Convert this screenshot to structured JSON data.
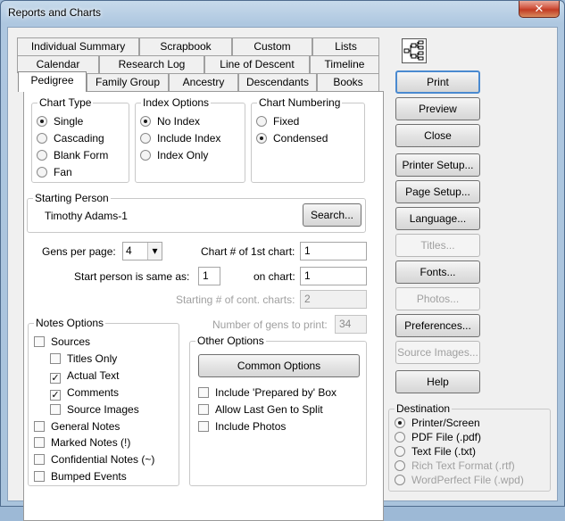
{
  "window": {
    "title": "Reports and Charts",
    "close_glyph": "✕"
  },
  "tabs_row1": [
    "Individual Summary",
    "Scrapbook",
    "Custom",
    "Lists"
  ],
  "tabs_row2": [
    "Calendar",
    "Research Log",
    "Line of Descent",
    "Timeline"
  ],
  "tabs_row3": [
    "Pedigree",
    "Family Group",
    "Ancestry",
    "Descendants",
    "Books"
  ],
  "chart_type": {
    "label": "Chart Type",
    "options": [
      "Single",
      "Cascading",
      "Blank Form",
      "Fan"
    ],
    "selected": "Single"
  },
  "index_options": {
    "label": "Index Options",
    "options": [
      "No Index",
      "Include Index",
      "Index Only"
    ],
    "selected": "No Index"
  },
  "chart_numbering": {
    "label": "Chart Numbering",
    "options": [
      "Fixed",
      "Condensed"
    ],
    "selected": "Condensed"
  },
  "starting_person": {
    "label": "Starting Person",
    "name": "Timothy Adams-1",
    "search_label": "Search..."
  },
  "gens": {
    "label": "Gens per page:",
    "value": "4",
    "arrow": "▾"
  },
  "chart_first": {
    "label": "Chart # of 1st chart:",
    "value": "1"
  },
  "start_same": {
    "label": "Start person is same as:",
    "value": "1"
  },
  "on_chart": {
    "label": "on chart:",
    "value": "1"
  },
  "starting_cont": {
    "label": "Starting # of cont. charts:",
    "value": "2"
  },
  "num_gens_print": {
    "label": "Number of gens to print:",
    "value": "34"
  },
  "notes_options": {
    "label": "Notes Options",
    "items": [
      {
        "text": "Sources",
        "checked": false
      },
      {
        "text": "Titles Only",
        "checked": false
      },
      {
        "text": "Actual Text",
        "checked": true
      },
      {
        "text": "Comments",
        "checked": true
      },
      {
        "text": "Source Images",
        "checked": false
      },
      {
        "text": "General Notes",
        "checked": false
      },
      {
        "text": "Marked Notes (!)",
        "checked": false
      },
      {
        "text": "Confidential Notes (~)",
        "checked": false
      },
      {
        "text": "Bumped Events",
        "checked": false
      }
    ]
  },
  "other_options": {
    "label": "Other Options",
    "common_label": "Common Options",
    "items": [
      {
        "text": "Include 'Prepared by' Box",
        "checked": false
      },
      {
        "text": "Allow Last Gen to Split",
        "checked": false
      },
      {
        "text": "Include Photos",
        "checked": false
      }
    ]
  },
  "buttons": {
    "print": "Print",
    "preview": "Preview",
    "close": "Close",
    "printer_setup": "Printer Setup...",
    "page_setup": "Page Setup...",
    "language": "Language...",
    "titles": "Titles...",
    "fonts": "Fonts...",
    "photos": "Photos...",
    "preferences": "Preferences...",
    "source_images": "Source Images...",
    "help": "Help"
  },
  "destination": {
    "label": "Destination",
    "options": [
      "Printer/Screen",
      "PDF File (.pdf)",
      "Text File (.txt)",
      "Rich Text Format (.rtf)",
      "WordPerfect File (.wpd)"
    ],
    "selected": "Printer/Screen"
  }
}
